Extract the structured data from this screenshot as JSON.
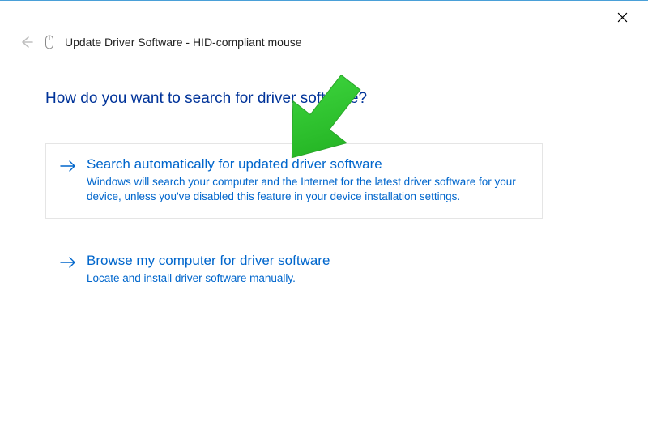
{
  "window": {
    "title": "Update Driver Software - HID-compliant mouse"
  },
  "page": {
    "heading": "How do you want to search for driver software?"
  },
  "options": [
    {
      "title": "Search automatically for updated driver software",
      "description": "Windows will search your computer and the Internet for the latest driver software for your device, unless you've disabled this feature in your device installation settings."
    },
    {
      "title": "Browse my computer for driver software",
      "description": "Locate and install driver software manually."
    }
  ]
}
